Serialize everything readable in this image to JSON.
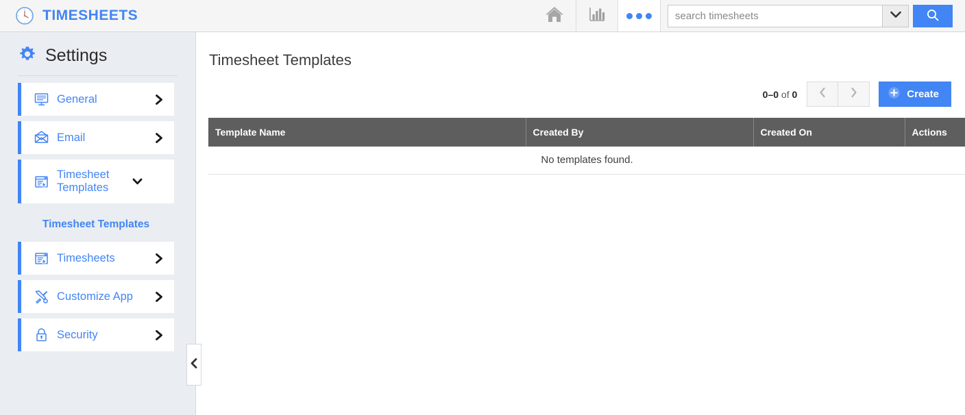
{
  "header": {
    "logo_icon": "clock-icon",
    "brand": "TIMESHEETS",
    "nav": [
      {
        "icon": "home-icon",
        "name": "home"
      },
      {
        "icon": "bar-chart-icon",
        "name": "reports"
      },
      {
        "icon": "more-dots-icon",
        "name": "more"
      }
    ],
    "search": {
      "placeholder": "search timesheets",
      "value": "",
      "dropdown_icon": "chevron-down-icon",
      "button_icon": "search-icon"
    }
  },
  "sidebar": {
    "title": "Settings",
    "title_icon": "gear-icon",
    "items": [
      {
        "label": "General",
        "icon": "monitor-icon",
        "chevron": "chevron-right-icon",
        "expanded": false
      },
      {
        "label": "Email",
        "icon": "envelope-icon",
        "chevron": "chevron-right-icon",
        "expanded": false
      },
      {
        "label": "Timesheet Templates",
        "icon": "template-window-icon",
        "chevron": "chevron-down-icon",
        "expanded": true
      }
    ],
    "section_label": "Timesheet Templates",
    "sub_items": [
      {
        "label": "Timesheets",
        "icon": "template-window-icon",
        "chevron": "chevron-right-icon"
      },
      {
        "label": "Customize App",
        "icon": "tools-icon",
        "chevron": "chevron-right-icon"
      },
      {
        "label": "Security",
        "icon": "lock-icon",
        "chevron": "chevron-right-icon"
      }
    ],
    "collapse_icon": "chevron-left-icon"
  },
  "main": {
    "page_title": "Timesheet Templates",
    "toolbar": {
      "range": "0–0",
      "of_text": "of",
      "total": "0",
      "prev_icon": "chevron-left-icon",
      "next_icon": "chevron-right-icon",
      "create_label": "Create",
      "create_icon": "plus-circle-icon"
    },
    "table": {
      "columns": [
        "Template Name",
        "Created By",
        "Created On",
        "Actions"
      ],
      "rows": [],
      "empty_message": "No templates found."
    }
  },
  "colors": {
    "accent_blue": "#4285f4",
    "header_bg": "#f5f5f5",
    "sidebar_bg": "#eaedf1",
    "table_header_bg": "#5f5e5e"
  }
}
